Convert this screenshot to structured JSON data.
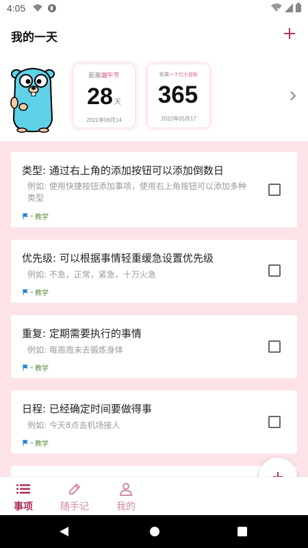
{
  "status_bar": {
    "time": "4:05"
  },
  "header": {
    "title": "我的一天"
  },
  "countdowns": [
    {
      "label_prefix": "距离",
      "label_highlight": "端午节",
      "number": "28",
      "unit": "天",
      "date": "2021年06月14"
    },
    {
      "label_prefix": "距离",
      "label_highlight": "一个亿小目标",
      "number": "365",
      "unit": "",
      "date": "2022年05月17"
    }
  ],
  "tasks": [
    {
      "title": "类型: 通过右上角的添加按钮可以添加倒数日",
      "desc": "例如: 使用快捷按钮添加事项，使用右上角按钮可以添加多种类型",
      "tag": "教学"
    },
    {
      "title": "优先级: 可以根据事情轻重缓急设置优先级",
      "desc": "例如: 不急，正常，紧急，十万火急",
      "tag": "教学"
    },
    {
      "title": "重复: 定期需要执行的事情",
      "desc": "例如: 每周周末去锻炼身体",
      "tag": "教学"
    },
    {
      "title": "日程: 已经确定时间要做得事",
      "desc": "例如: 今天8点去机场接人",
      "tag": "教学"
    }
  ],
  "bottom_nav": [
    {
      "label": "事项",
      "active": true
    },
    {
      "label": "随手记",
      "active": false
    },
    {
      "label": "我的",
      "active": false
    }
  ],
  "colors": {
    "accent": "#b0305a",
    "list_bg": "#fde3e8",
    "highlight": "#d84a7a",
    "tag_green": "#5a8a3a",
    "flag_blue": "#1e7fd8"
  }
}
